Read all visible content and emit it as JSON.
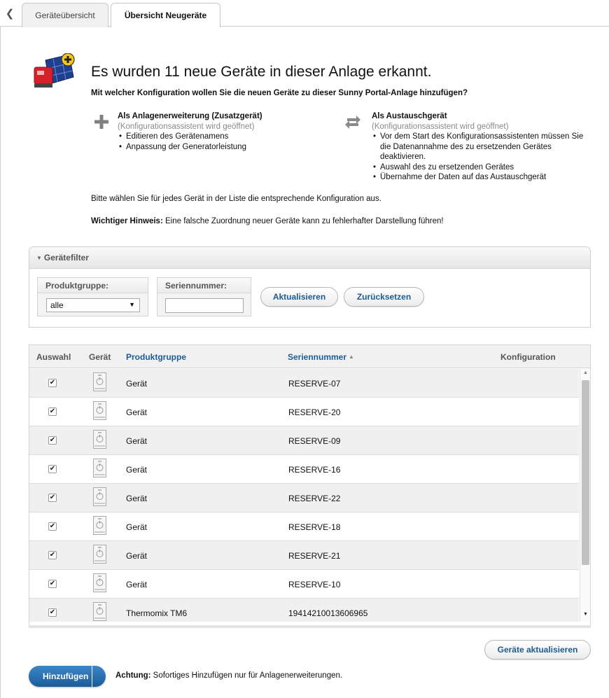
{
  "tabs": [
    {
      "label": "Geräteübersicht",
      "active": false
    },
    {
      "label": "Übersicht Neugeräte",
      "active": true
    }
  ],
  "headline": "Es wurden 11 neue Geräte in dieser Anlage erkannt.",
  "subheadline": "Mit welcher Konfiguration wollen Sie die neuen Geräte zu dieser Sunny Portal-Anlage hinzufügen?",
  "options": {
    "extension": {
      "title": "Als Anlagenerweiterung (Zusatzgerät)",
      "subtitle": "(Konfigurationsassistent wird geöffnet)",
      "bullets": [
        "Editieren des Gerätenamens",
        "Anpassung der Generatorleistung"
      ]
    },
    "replacement": {
      "title": "Als Austauschgerät",
      "subtitle": "(Konfigurationsassistent wird geöffnet)",
      "bullets": [
        "Vor dem Start des Konfigurationsassistenten müssen Sie die Datenannahme des zu ersetzenden Gerätes deaktivieren.",
        "Auswahl des zu ersetzenden Gerätes",
        "Übernahme der Daten auf das Austauschgerät"
      ]
    }
  },
  "instruction": "Bitte wählen Sie für jedes Gerät in der Liste die entsprechende Konfiguration aus.",
  "notice": {
    "label": "Wichtiger Hinweis:",
    "text": " Eine falsche Zuordnung neuer Geräte kann zu fehlerhafter Darstellung führen!"
  },
  "filter": {
    "title": "Gerätefilter",
    "product_group_label": "Produktgruppe:",
    "product_group_value": "alle",
    "serial_label": "Seriennummer:",
    "serial_value": "",
    "update_button": "Aktualisieren",
    "reset_button": "Zurücksetzen"
  },
  "table": {
    "columns": {
      "selection": "Auswahl",
      "device": "Gerät",
      "product_group": "Produktgruppe",
      "serial": "Seriennummer",
      "configuration": "Konfiguration"
    },
    "rows": [
      {
        "checked": true,
        "product_group": "Gerät",
        "serial": "RESERVE-07"
      },
      {
        "checked": true,
        "product_group": "Gerät",
        "serial": "RESERVE-20"
      },
      {
        "checked": true,
        "product_group": "Gerät",
        "serial": "RESERVE-09"
      },
      {
        "checked": true,
        "product_group": "Gerät",
        "serial": "RESERVE-16"
      },
      {
        "checked": true,
        "product_group": "Gerät",
        "serial": "RESERVE-22"
      },
      {
        "checked": true,
        "product_group": "Gerät",
        "serial": "RESERVE-18"
      },
      {
        "checked": true,
        "product_group": "Gerät",
        "serial": "RESERVE-21"
      },
      {
        "checked": true,
        "product_group": "Gerät",
        "serial": "RESERVE-10"
      },
      {
        "checked": true,
        "product_group": "Thermomix TM6",
        "serial": "19414210013606965"
      }
    ]
  },
  "update_devices_button": "Geräte aktualisieren",
  "add_button": "Hinzufügen",
  "warning": {
    "label": "Achtung:",
    "text": " Sofortiges Hinzufügen nur für Anlagenerweiterungen."
  },
  "colors": {
    "accent": "#1d5b93",
    "primary_button": "#2a74b6"
  }
}
